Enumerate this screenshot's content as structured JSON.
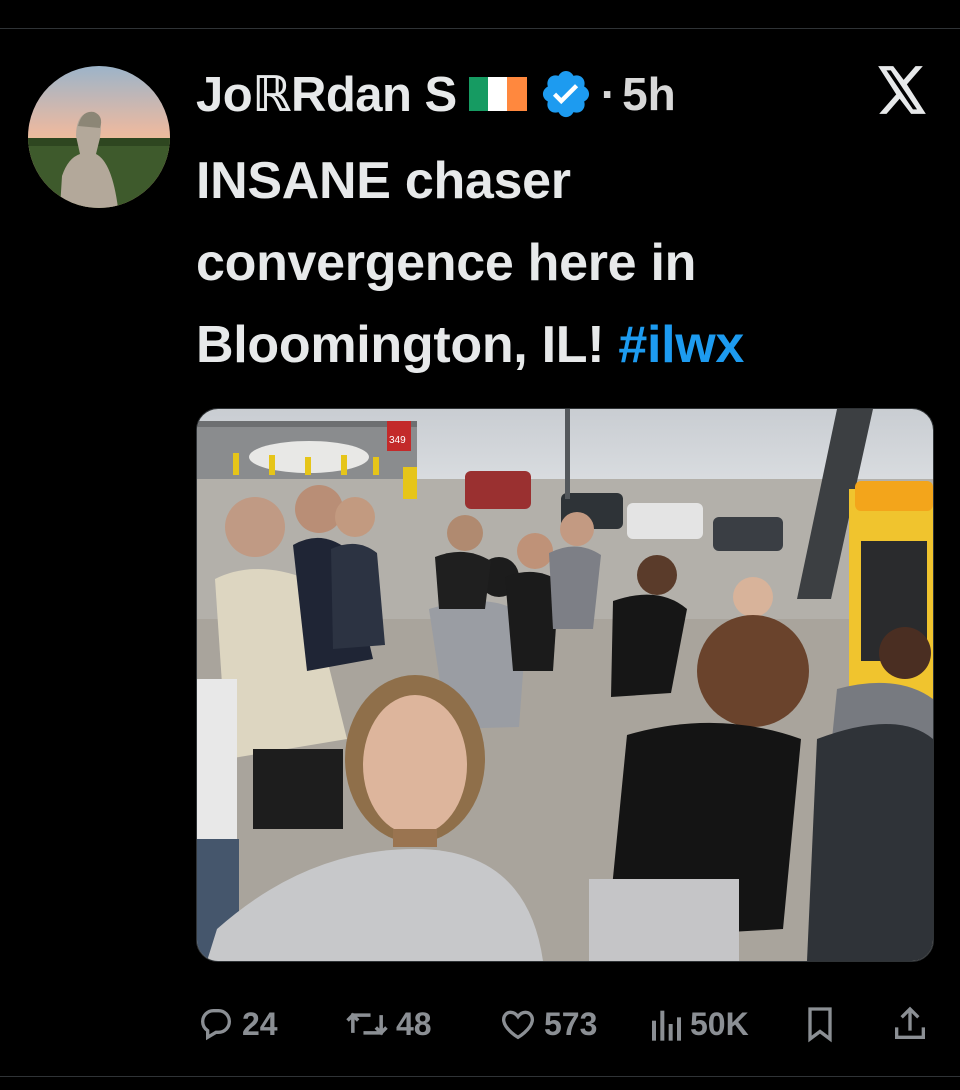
{
  "tweet": {
    "author": {
      "display_name": "JoℝRdan S",
      "flag_colors": [
        "#169b62",
        "#ffffff",
        "#ff883e"
      ],
      "verified_color": "#1d9bf0",
      "avatar_icon": "profile-photo"
    },
    "timestamp_separator": "·",
    "timestamp": "5h",
    "platform_logo": "x-logo",
    "text": {
      "body": "INSANE chaser convergence here in Bloomington, IL! ",
      "hashtag": "#ilwx"
    },
    "media": {
      "type": "photo",
      "sign_price": "349"
    },
    "metrics": {
      "replies": "24",
      "reposts": "48",
      "likes": "573",
      "views": "50K"
    },
    "action_icons": {
      "reply": "speech-bubble-icon",
      "repost": "repost-arrows-icon",
      "like": "heart-icon",
      "views": "bar-chart-icon",
      "bookmark": "bookmark-icon",
      "share": "share-icon"
    },
    "colors": {
      "background": "#000000",
      "text": "#e7e9ea",
      "muted": "#8b8f94",
      "link": "#1d9bf0"
    }
  }
}
